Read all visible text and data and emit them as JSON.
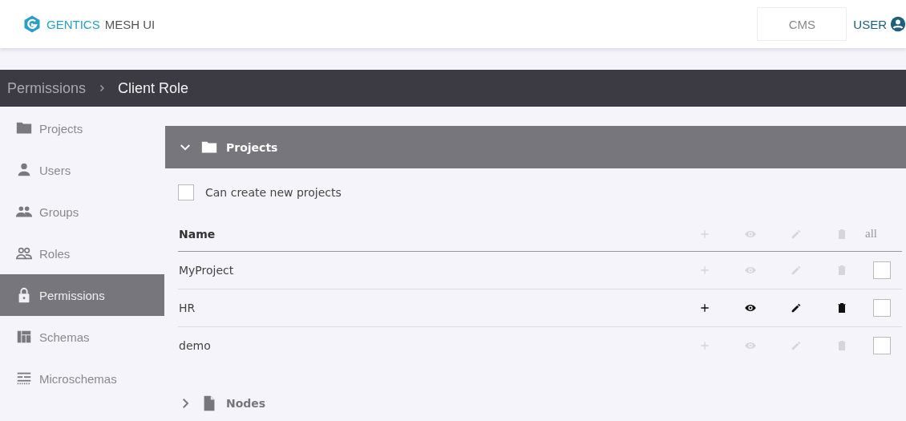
{
  "header": {
    "brand": "GENTICS",
    "product": "MESH UI",
    "cms_button": "CMS",
    "user_menu": "USER"
  },
  "breadcrumb": [
    {
      "label": "Permissions",
      "kind": "link"
    },
    {
      "label": "Client Role",
      "kind": "current"
    }
  ],
  "sidebar": {
    "items": [
      {
        "label": "Projects",
        "selected": false
      },
      {
        "label": "Users",
        "selected": false
      },
      {
        "label": "Groups",
        "selected": false
      },
      {
        "label": "Roles",
        "selected": false
      },
      {
        "label": "Permissions",
        "selected": true
      },
      {
        "label": "Schemas",
        "selected": false
      },
      {
        "label": "Microschemas",
        "selected": false
      }
    ]
  },
  "sections": [
    {
      "title": "Projects",
      "expanded": true,
      "create_option": {
        "label": "Can create new projects",
        "checked": false
      },
      "table": {
        "name_column": "Name",
        "all_column": "all",
        "rows": [
          {
            "name": "MyProject",
            "create": false,
            "read": false,
            "update": false,
            "delete": false,
            "all": false
          },
          {
            "name": "HR",
            "create": true,
            "read": true,
            "update": true,
            "delete": true,
            "all": false
          },
          {
            "name": "demo",
            "create": false,
            "read": false,
            "update": false,
            "delete": false,
            "all": false
          }
        ]
      }
    },
    {
      "title": "Nodes",
      "expanded": false
    }
  ]
}
